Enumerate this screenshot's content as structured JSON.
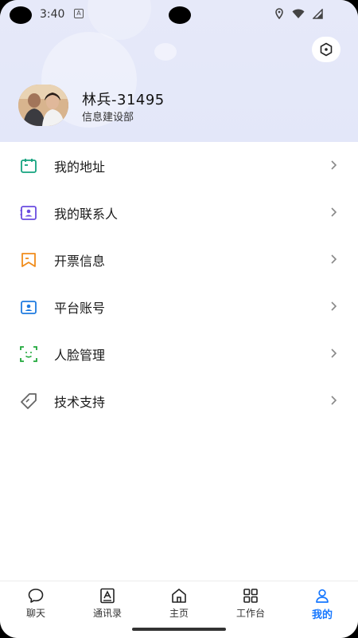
{
  "status_bar": {
    "time": "3:40",
    "notification_badge": "A"
  },
  "profile": {
    "name": "林兵-31495",
    "department": "信息建设部"
  },
  "menu": [
    {
      "label": "我的地址",
      "icon": "address-icon",
      "color": "#14a37f"
    },
    {
      "label": "我的联系人",
      "icon": "contact-card-icon",
      "color": "#6a4ce0"
    },
    {
      "label": "开票信息",
      "icon": "invoice-icon",
      "color": "#f08c1b"
    },
    {
      "label": "平台账号",
      "icon": "account-icon",
      "color": "#1f7be0"
    },
    {
      "label": "人脸管理",
      "icon": "face-scan-icon",
      "color": "#1fa83a"
    },
    {
      "label": "技术支持",
      "icon": "tag-icon",
      "color": "#666666"
    }
  ],
  "tabbar": [
    {
      "label": "聊天",
      "icon": "chat-icon"
    },
    {
      "label": "通讯录",
      "icon": "contacts-icon"
    },
    {
      "label": "主页",
      "icon": "home-icon"
    },
    {
      "label": "工作台",
      "icon": "grid-icon"
    },
    {
      "label": "我的",
      "icon": "user-icon",
      "active": true
    }
  ],
  "colors": {
    "accent": "#1677ff",
    "header_bg": "#e4e8f9"
  }
}
